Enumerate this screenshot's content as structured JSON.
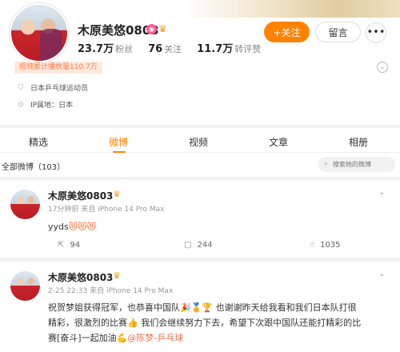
{
  "profile": {
    "username": "木原美悠0803",
    "stats": [
      {
        "value": "23.7万",
        "label": "粉丝"
      },
      {
        "value": "76",
        "label": "关注"
      },
      {
        "value": "11.7万",
        "label": "转评赞"
      }
    ],
    "follow_label": "+关注",
    "message_label": "留言",
    "more_label": "•••",
    "plays_label": "视频累计播放量110.7万",
    "bio": "日本乒乓球运动员",
    "ip_label": "IP属地：日本"
  },
  "tabs": [
    "精选",
    "微博",
    "视频",
    "文章",
    "相册"
  ],
  "active_tab": "微博",
  "feed": {
    "title": "全部微博（103）",
    "search_placeholder": "搜索她的微博"
  },
  "posts": [
    {
      "author": "木原美悠0803",
      "time": "17分钟前",
      "source": "来自 iPhone 14 Pro Max",
      "text": "yyds",
      "emojis": "😻😻😻",
      "shares": "94",
      "comments": "244",
      "likes": "1035"
    },
    {
      "author": "木原美悠0803",
      "time": "2-25 22:33",
      "source": "来自 iPhone 14 Pro Max",
      "line1": "祝贺梦姐获得冠军，也恭喜中国队🎉🏅🏆 也谢谢昨天给我看和我们日本队打很",
      "line2": "精彩，很激烈的比赛👍 我们会继续努力下去，希望下次跟中国队还能打精彩的比",
      "line3a": "赛[奋斗]一起加油💪",
      "mention": "@陈梦-乒乓球"
    }
  ],
  "colors": {
    "accent": "#ff8200",
    "link": "#eb7350",
    "plays_bg": "#fde9de"
  }
}
